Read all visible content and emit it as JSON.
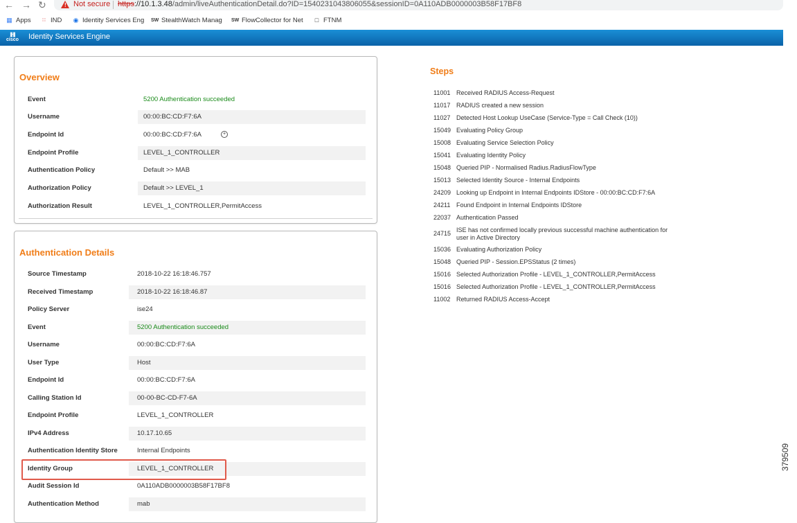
{
  "browser": {
    "not_secure": "Not secure",
    "url_proto": "https",
    "url_host": "://10.1.3.48",
    "url_path": "/admin/liveAuthenticationDetail.do?ID=1540231043806055&sessionID=0A110ADB0000003B58F17BF8",
    "bookmarks": [
      "Apps",
      "IND",
      "Identity Services Eng",
      "StealthWatch Manag",
      "FlowCollector for Net",
      "FTNM"
    ]
  },
  "app": {
    "logo": "cisco",
    "title": "Identity Services Engine"
  },
  "overview": {
    "title": "Overview",
    "rows": [
      {
        "key": "Event",
        "value": "5200 Authentication succeeded"
      },
      {
        "key": "Username",
        "value": "00:00:BC:CD:F7:6A"
      },
      {
        "key": "Endpoint Id",
        "value": "00:00:BC:CD:F7:6A"
      },
      {
        "key": "Endpoint Profile",
        "value": "LEVEL_1_CONTROLLER"
      },
      {
        "key": "Authentication Policy",
        "value": "Default >> MAB"
      },
      {
        "key": "Authorization Policy",
        "value": "Default >> LEVEL_1"
      },
      {
        "key": "Authorization Result",
        "value": "LEVEL_1_CONTROLLER,PermitAccess"
      }
    ]
  },
  "auth_details": {
    "title": "Authentication Details",
    "rows": [
      {
        "key": "Source Timestamp",
        "value": "2018-10-22 16:18:46.757"
      },
      {
        "key": "Received Timestamp",
        "value": "2018-10-22 16:18:46.87"
      },
      {
        "key": "Policy Server",
        "value": "ise24"
      },
      {
        "key": "Event",
        "value": "5200 Authentication succeeded"
      },
      {
        "key": "Username",
        "value": "00:00:BC:CD:F7:6A"
      },
      {
        "key": "User Type",
        "value": "Host"
      },
      {
        "key": "Endpoint Id",
        "value": "00:00:BC:CD:F7:6A"
      },
      {
        "key": "Calling Station Id",
        "value": "00-00-BC-CD-F7-6A"
      },
      {
        "key": "Endpoint Profile",
        "value": "LEVEL_1_CONTROLLER"
      },
      {
        "key": "IPv4 Address",
        "value": "10.17.10.65"
      },
      {
        "key": "Authentication Identity Store",
        "value": "Internal Endpoints"
      },
      {
        "key": "Identity Group",
        "value": "LEVEL_1_CONTROLLER"
      },
      {
        "key": "Audit Session Id",
        "value": "0A110ADB0000003B58F17BF8"
      },
      {
        "key": "Authentication Method",
        "value": "mab"
      }
    ]
  },
  "steps": {
    "title": "Steps",
    "items": [
      {
        "code": "11001",
        "desc": "Received RADIUS Access-Request"
      },
      {
        "code": "11017",
        "desc": "RADIUS created a new session"
      },
      {
        "code": "11027",
        "desc": "Detected Host Lookup UseCase (Service-Type = Call Check (10))"
      },
      {
        "code": "15049",
        "desc": "Evaluating Policy Group"
      },
      {
        "code": "15008",
        "desc": "Evaluating Service Selection Policy"
      },
      {
        "code": "15041",
        "desc": "Evaluating Identity Policy"
      },
      {
        "code": "15048",
        "desc": "Queried PIP - Normalised Radius.RadiusFlowType"
      },
      {
        "code": "15013",
        "desc": "Selected Identity Source - Internal Endpoints"
      },
      {
        "code": "24209",
        "desc": "Looking up Endpoint in Internal Endpoints IDStore - 00:00:BC:CD:F7:6A"
      },
      {
        "code": "24211",
        "desc": "Found Endpoint in Internal Endpoints IDStore"
      },
      {
        "code": "22037",
        "desc": "Authentication Passed"
      },
      {
        "code": "24715",
        "desc": "ISE has not confirmed locally previous successful machine authentication for user in Active Directory"
      },
      {
        "code": "15036",
        "desc": "Evaluating Authorization Policy"
      },
      {
        "code": "15048",
        "desc": "Queried PIP - Session.EPSStatus (2 times)"
      },
      {
        "code": "15016",
        "desc": "Selected Authorization Profile - LEVEL_1_CONTROLLER,PermitAccess"
      },
      {
        "code": "15016",
        "desc": "Selected Authorization Profile - LEVEL_1_CONTROLLER,PermitAccess"
      },
      {
        "code": "11002",
        "desc": "Returned RADIUS Access-Accept"
      }
    ]
  },
  "figure_number": "379509"
}
